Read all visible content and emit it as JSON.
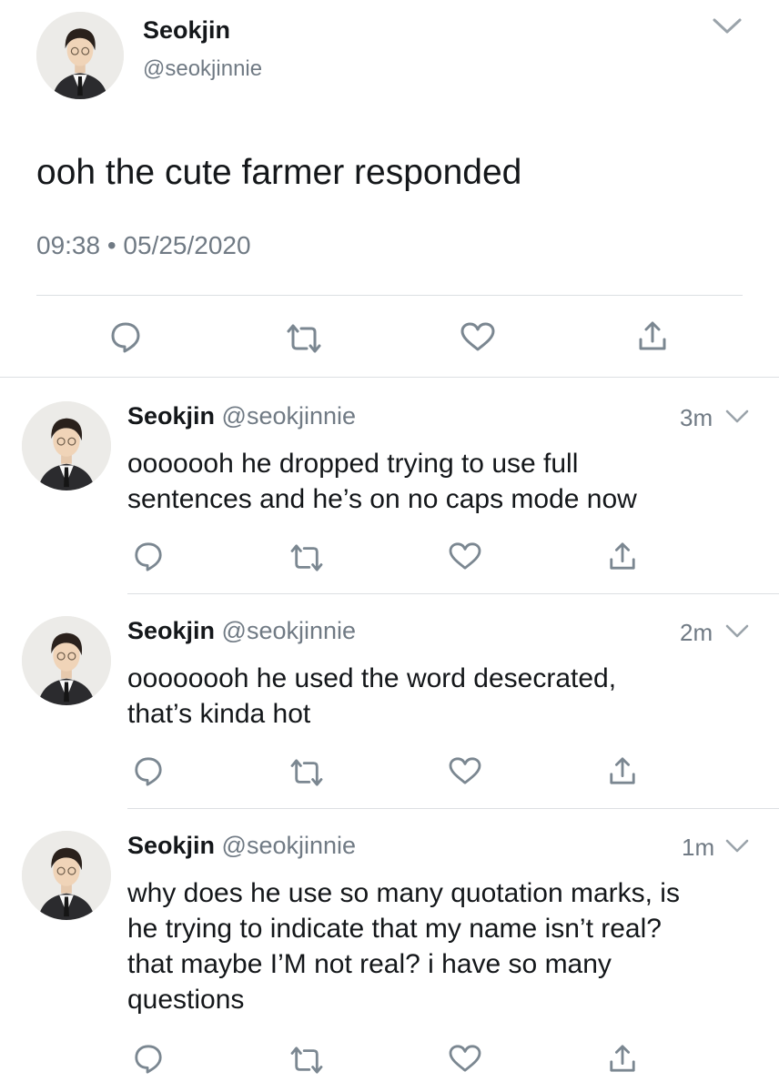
{
  "main_tweet": {
    "display_name": "Seokjin",
    "handle": "@seokjinnie",
    "text": "ooh the cute farmer responded",
    "timestamp": "09:38 • 05/25/2020"
  },
  "replies": [
    {
      "display_name": "Seokjin",
      "handle": "@seokjinnie",
      "time": "3m",
      "text_lines": [
        "ooooooh he dropped trying to use full",
        "sentences and he’s on no caps mode now"
      ]
    },
    {
      "display_name": "Seokjin",
      "handle": "@seokjinnie",
      "time": "2m",
      "text_lines": [
        "oooooooh he used the word desecrated,",
        "that’s kinda hot"
      ]
    },
    {
      "display_name": "Seokjin",
      "handle": "@seokjinnie",
      "time": "1m",
      "text_lines": [
        "why does he use so many quotation marks, is",
        "he trying to indicate that my name isn’t real?",
        "that maybe I’M not real? i have so many",
        "questions"
      ]
    }
  ],
  "icons": {
    "reply": "reply-icon",
    "retweet": "retweet-icon",
    "like": "heart-icon",
    "share": "share-icon",
    "menu": "chevron-down-icon"
  },
  "colors": {
    "icon": "#7b8791",
    "text": "#14171a",
    "secondary": "#707a84",
    "divider": "#dcdfe2"
  }
}
